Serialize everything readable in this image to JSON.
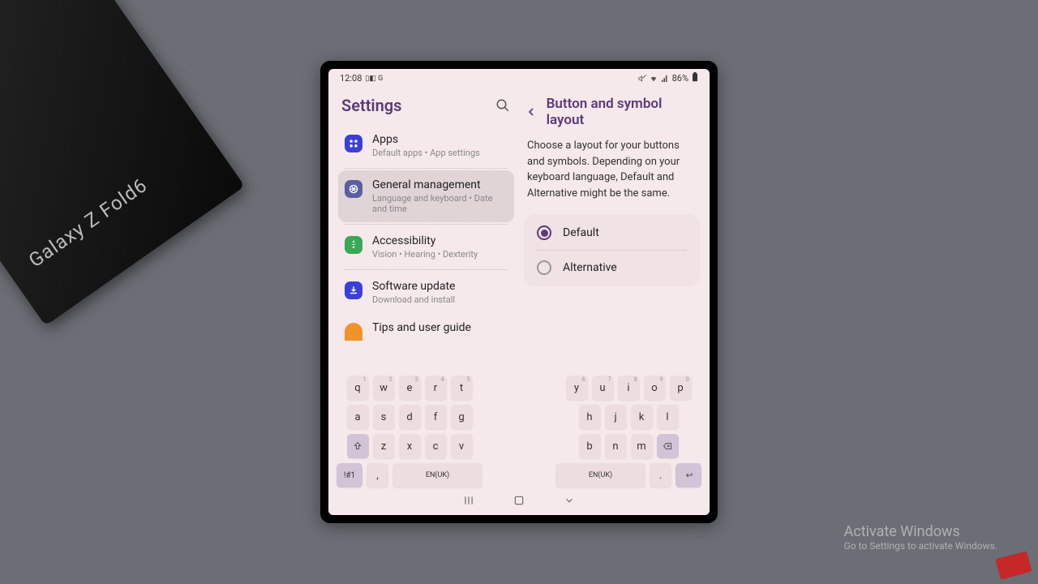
{
  "box_label": "Galaxy Z Fold6",
  "status": {
    "time": "12:08",
    "indicators": "▯◧ G",
    "battery": "86%",
    "signal_icons": "🔇 📶 📱"
  },
  "settings": {
    "title": "Settings",
    "items": [
      {
        "title": "Apps",
        "subtitle": "Default apps  •  App settings",
        "color": "#3b3fd8"
      },
      {
        "title": "General management",
        "subtitle": "Language and keyboard  •  Date and time",
        "color": "#5b5fa0"
      },
      {
        "title": "Accessibility",
        "subtitle": "Vision  •  Hearing  •  Dexterity",
        "color": "#3aa856"
      },
      {
        "title": "Software update",
        "subtitle": "Download and install",
        "color": "#3b3fd8"
      },
      {
        "title": "Tips and user guide",
        "subtitle": "",
        "color": "#f0932b"
      }
    ]
  },
  "detail": {
    "title": "Button and symbol layout",
    "description": "Choose a layout for your buttons and symbols. Depending on your keyboard language, Default and Alternative might be the same.",
    "options": [
      {
        "label": "Default",
        "checked": true
      },
      {
        "label": "Alternative",
        "checked": false
      }
    ]
  },
  "keyboard": {
    "left": {
      "row1": [
        {
          "k": "q",
          "s": "1"
        },
        {
          "k": "w",
          "s": "2"
        },
        {
          "k": "e",
          "s": "3"
        },
        {
          "k": "r",
          "s": "4"
        },
        {
          "k": "t",
          "s": "5"
        }
      ],
      "row2": [
        {
          "k": "a"
        },
        {
          "k": "s"
        },
        {
          "k": "d"
        },
        {
          "k": "f"
        },
        {
          "k": "g"
        }
      ],
      "row3": [
        {
          "k": "z"
        },
        {
          "k": "x"
        },
        {
          "k": "c"
        },
        {
          "k": "v"
        }
      ],
      "sym": "!#1",
      "comma": ",",
      "lang": "EN(UK)"
    },
    "right": {
      "row1": [
        {
          "k": "y",
          "s": "6"
        },
        {
          "k": "u",
          "s": "7"
        },
        {
          "k": "i",
          "s": "8"
        },
        {
          "k": "o",
          "s": "9"
        },
        {
          "k": "p",
          "s": "0"
        }
      ],
      "row2": [
        {
          "k": "h"
        },
        {
          "k": "j"
        },
        {
          "k": "k"
        },
        {
          "k": "l"
        }
      ],
      "row3": [
        {
          "k": "b"
        },
        {
          "k": "n"
        },
        {
          "k": "m"
        }
      ],
      "lang": "EN(UK)",
      "period": "."
    }
  },
  "watermark": {
    "title": "Activate Windows",
    "sub": "Go to Settings to activate Windows."
  }
}
